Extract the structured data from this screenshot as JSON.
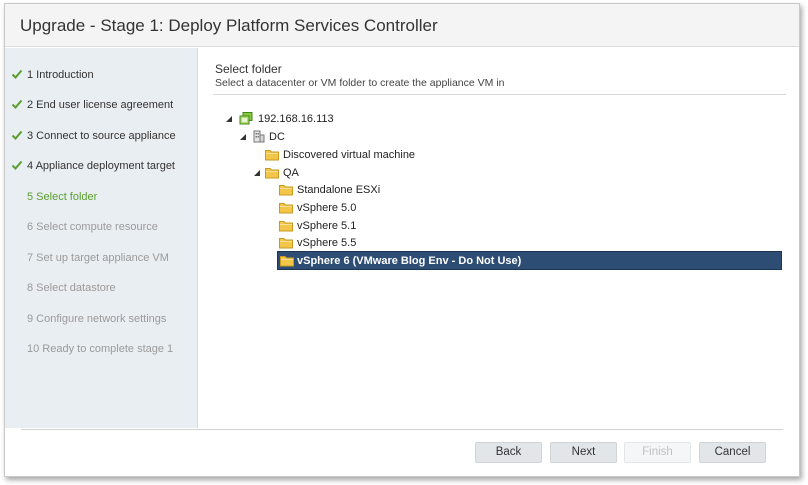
{
  "window": {
    "title": "Upgrade - Stage 1: Deploy Platform Services Controller"
  },
  "steps": [
    {
      "label": "1 Introduction",
      "state": "done"
    },
    {
      "label": "2 End user license agreement",
      "state": "done"
    },
    {
      "label": "3 Connect to source appliance",
      "state": "done"
    },
    {
      "label": "4 Appliance deployment target",
      "state": "done"
    },
    {
      "label": "5 Select folder",
      "state": "current"
    },
    {
      "label": "6 Select compute resource",
      "state": "pending"
    },
    {
      "label": "7 Set up target appliance VM",
      "state": "pending"
    },
    {
      "label": "8 Select datastore",
      "state": "pending"
    },
    {
      "label": "9 Configure network settings",
      "state": "pending"
    },
    {
      "label": "10 Ready to complete stage 1",
      "state": "pending"
    }
  ],
  "main": {
    "title": "Select folder",
    "subtitle": "Select a datacenter or VM folder to create the appliance VM in"
  },
  "tree": {
    "host": {
      "label": "192.168.16.113",
      "icon": "vcenter-host-icon"
    },
    "dc": {
      "label": "DC",
      "icon": "datacenter-icon"
    },
    "discovered": {
      "label": "Discovered virtual machine",
      "icon": "folder-icon"
    },
    "qa": {
      "label": "QA",
      "icon": "folder-icon"
    },
    "qa_children": [
      {
        "label": "Standalone ESXi",
        "icon": "folder-icon"
      },
      {
        "label": "vSphere 5.0",
        "icon": "folder-icon"
      },
      {
        "label": "vSphere 5.1",
        "icon": "folder-icon"
      },
      {
        "label": "vSphere 5.5",
        "icon": "folder-icon"
      },
      {
        "label": "vSphere 6 (VMware Blog Env - Do Not Use)",
        "icon": "folder-icon",
        "selected": true
      }
    ]
  },
  "buttons": {
    "back": "Back",
    "next": "Next",
    "finish": "Finish",
    "cancel": "Cancel"
  },
  "colors": {
    "accent_green": "#5a9e2f",
    "selection_bg": "#2e4d74",
    "sidebar_bg": "#e9eef3",
    "folder_yellow": "#f3c64a"
  }
}
